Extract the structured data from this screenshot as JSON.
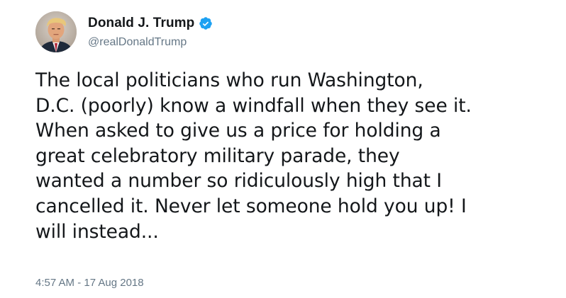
{
  "author": {
    "display_name": "Donald J. Trump",
    "handle": "@realDonaldTrump",
    "verified_icon": "verified-badge-icon",
    "avatar_icon": "avatar"
  },
  "tweet": {
    "text": "The local politicians who run Washington,\nD.C. (poorly) know a windfall when they see it.\nWhen asked to give us a price for holding a\ngreat celebratory military parade, they\nwanted a number so ridiculously high that I\ncancelled it. Never let someone hold you up! I\nwill instead...",
    "timestamp": "4:57 AM - 17 Aug 2018"
  },
  "colors": {
    "text": "#14171a",
    "secondary": "#657786",
    "verified_blue": "#1da1f2"
  }
}
